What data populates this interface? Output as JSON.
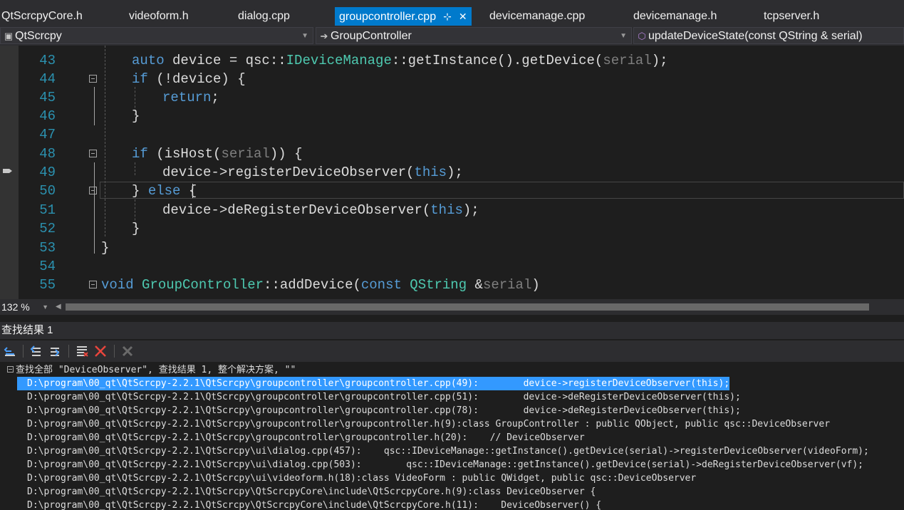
{
  "tabs": [
    {
      "label": "QtScrcpyCore.h",
      "active": false
    },
    {
      "label": "videoform.h",
      "active": false
    },
    {
      "label": "dialog.cpp",
      "active": false
    },
    {
      "label": "groupcontroller.cpp",
      "active": true
    },
    {
      "label": "devicemanage.cpp",
      "active": false
    },
    {
      "label": "devicemanage.h",
      "active": false
    },
    {
      "label": "tcpserver.h",
      "active": false
    }
  ],
  "tab_pin_glyph": "⊹",
  "tab_close_glyph": "✕",
  "nav": {
    "project": "QtScrcpy",
    "class": "GroupController",
    "member": "updateDeviceState(const QString & serial)",
    "class_icon": "arrow-right-icon",
    "member_icon": "method-cube-icon"
  },
  "code_lines": [
    {
      "num": "43"
    },
    {
      "num": "44"
    },
    {
      "num": "45"
    },
    {
      "num": "46"
    },
    {
      "num": "47"
    },
    {
      "num": "48"
    },
    {
      "num": "49"
    },
    {
      "num": "50"
    },
    {
      "num": "51"
    },
    {
      "num": "52"
    },
    {
      "num": "53"
    },
    {
      "num": "54"
    },
    {
      "num": "55"
    }
  ],
  "code_text": {
    "l43_auto": "auto",
    "l43_a": " device = qsc::",
    "l43_type": "IDeviceManage",
    "l43_b": "::getInstance().getDevice(",
    "l43_param": "serial",
    "l43_c": ");",
    "l44_if": "if",
    "l44_a": " (!device) {",
    "l45_return": "return",
    "l45_a": ";",
    "l46_a": "}",
    "l48_if": "if",
    "l48_a": " (isHost(",
    "l48_param": "serial",
    "l48_b": ")) {",
    "l49_a": "device->registerDeviceObserver(",
    "l49_this": "this",
    "l49_b": ");",
    "l50_a": "} ",
    "l50_else": "else",
    "l50_b": " {",
    "l51_a": "device->deRegisterDeviceObserver(",
    "l51_this": "this",
    "l51_b": ");",
    "l52_a": "}",
    "l53_a": "}",
    "l55_void": "void",
    "l55_class": "GroupController",
    "l55_a": "::addDevice(",
    "l55_const": "const",
    "l55_qstring": "QString",
    "l55_b": " &",
    "l55_param": "serial",
    "l55_c": ")"
  },
  "zoom": "132 %",
  "panel_title": "查找结果 1",
  "toolbar_icons": [
    "go-to-location-icon",
    "previous-result-icon",
    "next-result-icon",
    "clear-results-icon",
    "close-x-icon",
    "stop-search-icon"
  ],
  "results_header": "查找全部 \"DeviceObserver\", 查找结果 1, 整个解决方案, \"\"",
  "results": [
    "D:\\program\\00_qt\\QtScrcpy-2.2.1\\QtScrcpy\\groupcontroller\\groupcontroller.cpp(49):        device->registerDeviceObserver(this);",
    "D:\\program\\00_qt\\QtScrcpy-2.2.1\\QtScrcpy\\groupcontroller\\groupcontroller.cpp(51):        device->deRegisterDeviceObserver(this);",
    "D:\\program\\00_qt\\QtScrcpy-2.2.1\\QtScrcpy\\groupcontroller\\groupcontroller.cpp(78):        device->deRegisterDeviceObserver(this);",
    "D:\\program\\00_qt\\QtScrcpy-2.2.1\\QtScrcpy\\groupcontroller\\groupcontroller.h(9):class GroupController : public QObject, public qsc::DeviceObserver",
    "D:\\program\\00_qt\\QtScrcpy-2.2.1\\QtScrcpy\\groupcontroller\\groupcontroller.h(20):    // DeviceObserver",
    "D:\\program\\00_qt\\QtScrcpy-2.2.1\\QtScrcpy\\ui\\dialog.cpp(457):    qsc::IDeviceManage::getInstance().getDevice(serial)->registerDeviceObserver(videoForm);",
    "D:\\program\\00_qt\\QtScrcpy-2.2.1\\QtScrcpy\\ui\\dialog.cpp(503):        qsc::IDeviceManage::getInstance().getDevice(serial)->deRegisterDeviceObserver(vf);",
    "D:\\program\\00_qt\\QtScrcpy-2.2.1\\QtScrcpy\\ui\\videoform.h(18):class VideoForm : public QWidget, public qsc::DeviceObserver",
    "D:\\program\\00_qt\\QtScrcpy-2.2.1\\QtScrcpy\\QtScrcpyCore\\include\\QtScrcpyCore.h(9):class DeviceObserver {",
    "D:\\program\\00_qt\\QtScrcpy-2.2.1\\QtScrcpy\\QtScrcpyCore\\include\\QtScrcpyCore.h(11):    DeviceObserver() {"
  ],
  "colors": {
    "accent": "#007acc",
    "selection": "#3399ff",
    "keyword": "#569cd6",
    "type": "#4ec9b0",
    "line_number": "#2b91af",
    "param": "#7f7f7f"
  }
}
